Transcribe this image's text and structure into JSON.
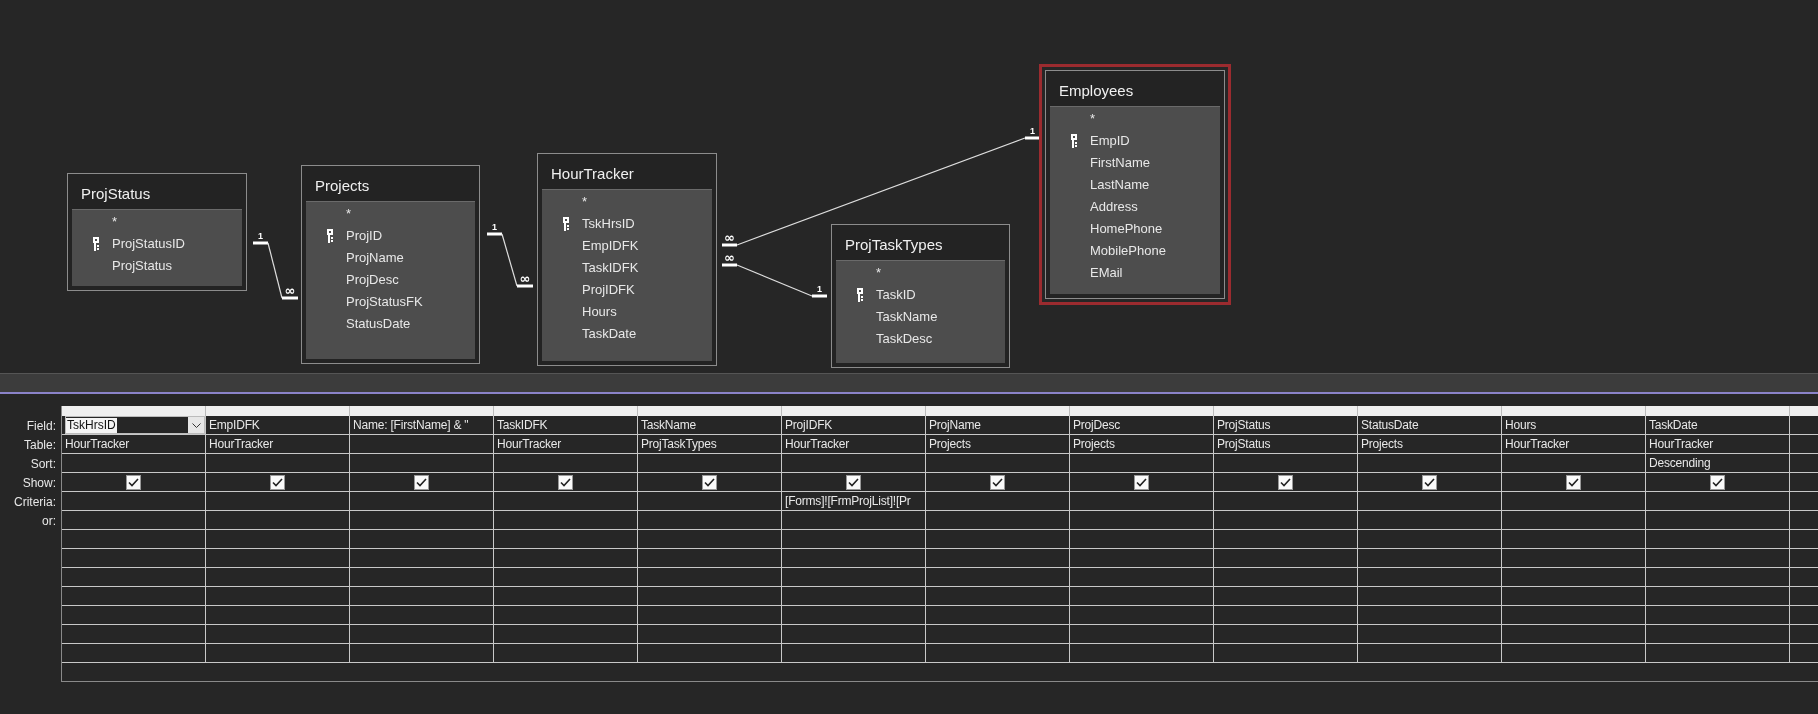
{
  "tables": [
    {
      "title": "ProjStatus",
      "selected": false,
      "fields": [
        {
          "name": "*",
          "key": false
        },
        {
          "name": "ProjStatusID",
          "key": true
        },
        {
          "name": "ProjStatus",
          "key": false
        }
      ]
    },
    {
      "title": "Projects",
      "selected": false,
      "fields": [
        {
          "name": "*",
          "key": false
        },
        {
          "name": "ProjID",
          "key": true
        },
        {
          "name": "ProjName",
          "key": false
        },
        {
          "name": "ProjDesc",
          "key": false
        },
        {
          "name": "ProjStatusFK",
          "key": false
        },
        {
          "name": "StatusDate",
          "key": false
        }
      ]
    },
    {
      "title": "HourTracker",
      "selected": false,
      "fields": [
        {
          "name": "*",
          "key": false
        },
        {
          "name": "TskHrsID",
          "key": true
        },
        {
          "name": "EmpIDFK",
          "key": false
        },
        {
          "name": "TaskIDFK",
          "key": false
        },
        {
          "name": "ProjIDFK",
          "key": false
        },
        {
          "name": "Hours",
          "key": false
        },
        {
          "name": "TaskDate",
          "key": false
        }
      ]
    },
    {
      "title": "ProjTaskTypes",
      "selected": false,
      "fields": [
        {
          "name": "*",
          "key": false
        },
        {
          "name": "TaskID",
          "key": true
        },
        {
          "name": "TaskName",
          "key": false
        },
        {
          "name": "TaskDesc",
          "key": false
        }
      ]
    },
    {
      "title": "Employees",
      "selected": true,
      "fields": [
        {
          "name": "*",
          "key": false
        },
        {
          "name": "EmpID",
          "key": true
        },
        {
          "name": "FirstName",
          "key": false
        },
        {
          "name": "LastName",
          "key": false
        },
        {
          "name": "Address",
          "key": false
        },
        {
          "name": "HomePhone",
          "key": false
        },
        {
          "name": "MobilePhone",
          "key": false
        },
        {
          "name": "EMail",
          "key": false
        }
      ]
    }
  ],
  "relationships": [
    {
      "one_label": "1",
      "many_label": "∞"
    },
    {
      "one_label": "1",
      "many_label": "∞"
    },
    {
      "one_label": "1",
      "many_label": "∞"
    },
    {
      "one_label": "1",
      "many_label": "∞"
    }
  ],
  "grid": {
    "row_labels": [
      "Field:",
      "Table:",
      "Sort:",
      "Show:",
      "Criteria:",
      "or:"
    ],
    "columns": [
      {
        "field": "TskHrsID",
        "selected": true,
        "table": "HourTracker",
        "show": true
      },
      {
        "field": "EmpIDFK",
        "selected": false,
        "table": "HourTracker",
        "show": true
      },
      {
        "field": "Name: [FirstName] & \"",
        "selected": false,
        "show": true
      },
      {
        "field": "TaskIDFK",
        "selected": false,
        "table": "HourTracker",
        "show": true
      },
      {
        "field": "TaskName",
        "selected": false,
        "table": "ProjTaskTypes",
        "show": true
      },
      {
        "field": "ProjIDFK",
        "selected": false,
        "table": "HourTracker",
        "show": true,
        "criteria": "[Forms]![FrmProjList]![Pr"
      },
      {
        "field": "ProjName",
        "selected": false,
        "table": "Projects",
        "show": true
      },
      {
        "field": "ProjDesc",
        "selected": false,
        "table": "Projects",
        "show": true
      },
      {
        "field": "ProjStatus",
        "selected": false,
        "table": "ProjStatus",
        "show": true
      },
      {
        "field": "StatusDate",
        "selected": false,
        "table": "Projects",
        "show": true
      },
      {
        "field": "Hours",
        "selected": false,
        "table": "HourTracker",
        "show": true
      },
      {
        "field": "TaskDate",
        "selected": false,
        "table": "HourTracker",
        "sort": "Descending",
        "show": true
      }
    ]
  }
}
